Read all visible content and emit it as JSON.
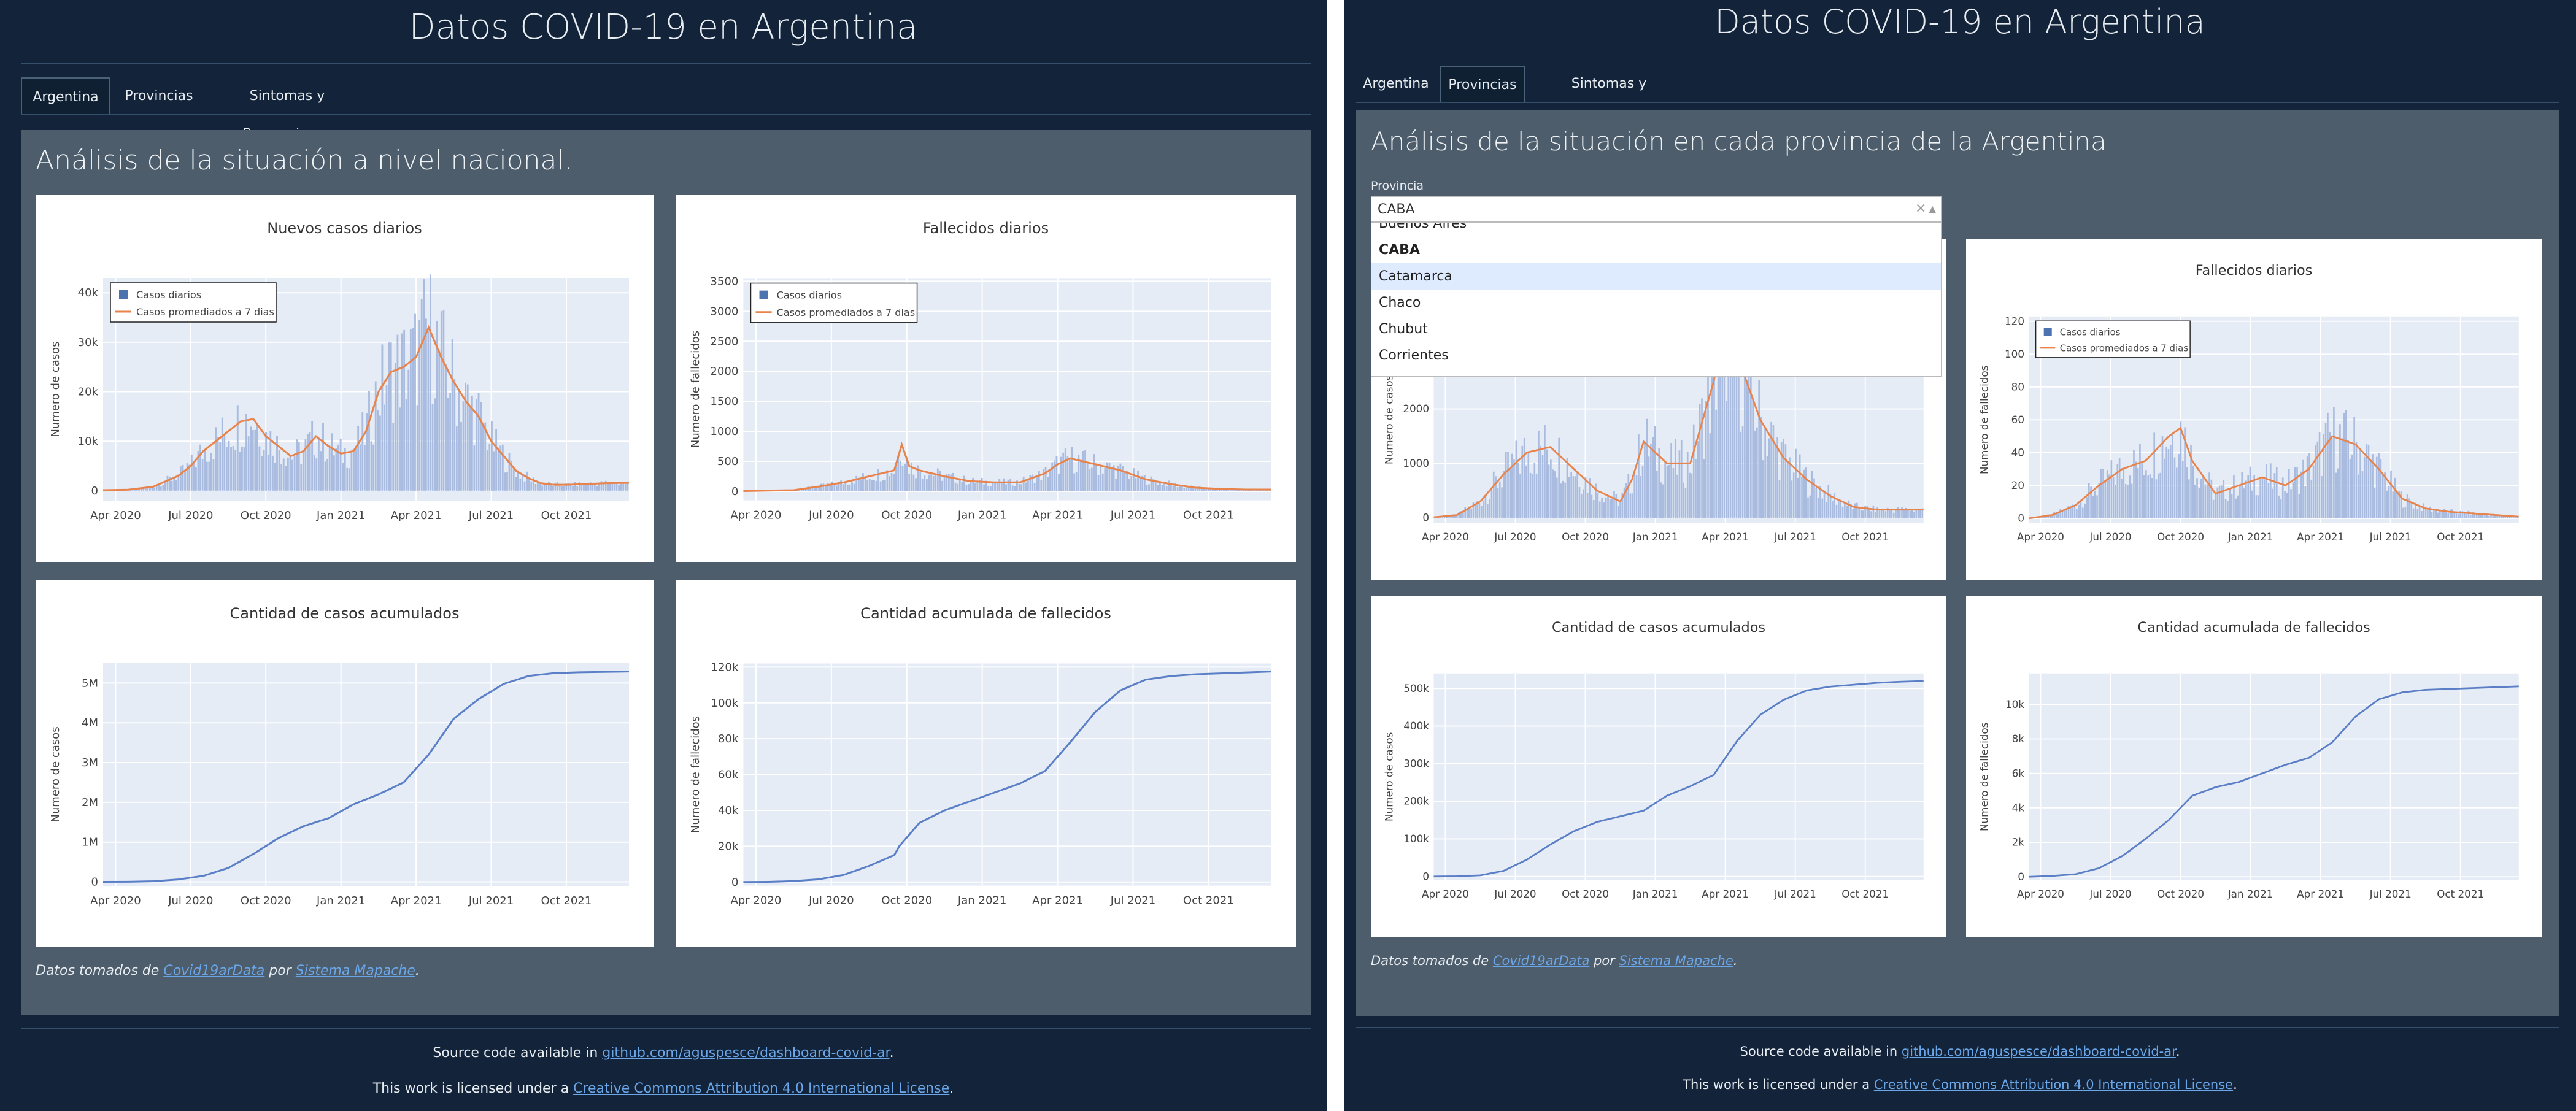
{
  "app": {
    "title": "Datos COVID-19 en Argentina"
  },
  "tabs": [
    {
      "label": "Argentina"
    },
    {
      "label": "Provincias"
    },
    {
      "label": "Sintomas y Precauciones"
    }
  ],
  "national": {
    "heading": "Análisis de la situación a nivel nacional."
  },
  "provincial": {
    "heading": "Análisis de la situación en cada provincia de la Argentina",
    "dropdown": {
      "label": "Provincia",
      "value": "CABA",
      "clear_glyph": "×",
      "arrow_glyph": "▲",
      "options": [
        "Buenos Aires",
        "CABA",
        "Catamarca",
        "Chaco",
        "Chubut",
        "Corrientes"
      ],
      "selected": "CABA",
      "highlighted": "Catamarca"
    }
  },
  "caption": {
    "prefix": "Datos tomados de ",
    "source": "Covid19arData",
    "mid": " por ",
    "author": "Sistema Mapache",
    "suffix": "."
  },
  "footer": {
    "line1_prefix": "Source code available in ",
    "line1_link": "github.com/aguspesce/dashboard-covid-ar",
    "line1_suffix": ".",
    "line2_prefix": "This work is licensed under a ",
    "line2_link": "Creative Commons Attribution 4.0 International License",
    "line2_suffix": "."
  },
  "colors": {
    "page_bg": "#12233a",
    "panel_bg": "#4d5d6c",
    "plot_bg": "#e5ecf6",
    "bar": "#a9bce0",
    "bar_legend": "#4c72b0",
    "avg_line": "#e8834b",
    "cum_line": "#5b7fc7",
    "link": "#6ba7e8"
  },
  "chart_data": [
    {
      "id": "ar-daily-cases",
      "type": "bar+line",
      "title": "Nuevos casos diarios",
      "xlabel": "",
      "ylabel": "Numero de casos",
      "x_ticks": [
        "Apr 2020",
        "Jul 2020",
        "Oct 2020",
        "Jan 2021",
        "Apr 2021",
        "Jul 2021",
        "Oct 2021"
      ],
      "y_ticks": [
        "0",
        "10k",
        "20k",
        "30k",
        "40k"
      ],
      "y_tick_values": [
        0,
        10000,
        20000,
        30000,
        40000
      ],
      "ylim": [
        -2000,
        43000
      ],
      "xlim": [
        0,
        21
      ],
      "legend": {
        "position": "top-left",
        "entries": [
          "Casos diarios",
          "Casos promediados a 7 dias"
        ]
      },
      "series": [
        {
          "name": "Casos promediados a 7 dias",
          "x": [
            0,
            1,
            2,
            3,
            3.5,
            4,
            4.5,
            5,
            5.5,
            6,
            6.5,
            7,
            7.5,
            8,
            8.5,
            9,
            9.5,
            10,
            10.5,
            11,
            11.5,
            12,
            12.5,
            13,
            13.5,
            14,
            14.5,
            15,
            15.5,
            16,
            16.5,
            17,
            17.5,
            18,
            18.5,
            19,
            19.5,
            20,
            21
          ],
          "y": [
            100,
            200,
            800,
            3000,
            5000,
            8000,
            10000,
            12000,
            14000,
            14500,
            11000,
            9000,
            7000,
            8000,
            11000,
            9000,
            7500,
            8000,
            12000,
            20000,
            24000,
            25000,
            27000,
            33000,
            27000,
            22000,
            18000,
            15000,
            10000,
            7000,
            4000,
            2500,
            1500,
            1200,
            1200,
            1300,
            1400,
            1500,
            1600
          ]
        }
      ]
    },
    {
      "id": "ar-daily-deaths",
      "type": "bar+line",
      "title": "Fallecidos diarios",
      "xlabel": "",
      "ylabel": "Numero de fallecidos",
      "x_ticks": [
        "Apr 2020",
        "Jul 2020",
        "Oct 2020",
        "Jan 2021",
        "Apr 2021",
        "Jul 2021",
        "Oct 2021"
      ],
      "y_ticks": [
        "0",
        "500",
        "1000",
        "1500",
        "2000",
        "2500",
        "3000",
        "3500"
      ],
      "y_tick_values": [
        0,
        500,
        1000,
        1500,
        2000,
        2500,
        3000,
        3500
      ],
      "ylim": [
        -150,
        3550
      ],
      "xlim": [
        0,
        21
      ],
      "legend": {
        "position": "top-left",
        "entries": [
          "Casos diarios",
          "Casos promediados a 7 dias"
        ]
      },
      "series": [
        {
          "name": "Casos promediados a 7 dias",
          "x": [
            0,
            2,
            3,
            4,
            5,
            6,
            6.3,
            6.6,
            7,
            8,
            9,
            10,
            11,
            12,
            12.5,
            13,
            13.5,
            14,
            15,
            16,
            17,
            18,
            19,
            20,
            21
          ],
          "y": [
            5,
            20,
            80,
            150,
            250,
            350,
            780,
            420,
            350,
            250,
            170,
            150,
            150,
            300,
            450,
            550,
            500,
            450,
            350,
            200,
            120,
            60,
            40,
            30,
            30
          ]
        }
      ]
    },
    {
      "id": "ar-cum-cases",
      "type": "line",
      "title": "Cantidad de casos acumulados",
      "xlabel": "",
      "ylabel": "Numero de casos",
      "x_ticks": [
        "Apr 2020",
        "Jul 2020",
        "Oct 2020",
        "Jan 2021",
        "Apr 2021",
        "Jul 2021",
        "Oct 2021"
      ],
      "y_ticks": [
        "0",
        "1M",
        "2M",
        "3M",
        "4M",
        "5M"
      ],
      "y_tick_values": [
        0,
        1000000,
        2000000,
        3000000,
        4000000,
        5000000
      ],
      "ylim": [
        -100000,
        5500000
      ],
      "xlim": [
        0,
        21
      ],
      "series": [
        {
          "name": "",
          "x": [
            0,
            1,
            2,
            3,
            4,
            5,
            6,
            7,
            8,
            9,
            10,
            11,
            12,
            13,
            14,
            15,
            16,
            17,
            18,
            19,
            20,
            21
          ],
          "y": [
            0,
            2000,
            15000,
            60000,
            150000,
            350000,
            700000,
            1100000,
            1400000,
            1600000,
            1950000,
            2200000,
            2500000,
            3200000,
            4100000,
            4600000,
            4980000,
            5180000,
            5250000,
            5270000,
            5280000,
            5290000
          ]
        }
      ]
    },
    {
      "id": "ar-cum-deaths",
      "type": "line",
      "title": "Cantidad acumulada de fallecidos",
      "xlabel": "",
      "ylabel": "Numero de fallecidos",
      "x_ticks": [
        "Apr 2020",
        "Jul 2020",
        "Oct 2020",
        "Jan 2021",
        "Apr 2021",
        "Jul 2021",
        "Oct 2021"
      ],
      "y_ticks": [
        "0",
        "20k",
        "40k",
        "60k",
        "80k",
        "100k",
        "120k"
      ],
      "y_tick_values": [
        0,
        20000,
        40000,
        60000,
        80000,
        100000,
        120000
      ],
      "ylim": [
        -2000,
        122000
      ],
      "xlim": [
        0,
        21
      ],
      "series": [
        {
          "name": "",
          "x": [
            0,
            1,
            2,
            3,
            4,
            5,
            6,
            6.2,
            7,
            8,
            9,
            10,
            11,
            12,
            13,
            14,
            15,
            16,
            17,
            18,
            19,
            20,
            21
          ],
          "y": [
            0,
            100,
            500,
            1500,
            4000,
            9000,
            15000,
            20000,
            33000,
            40000,
            45000,
            50000,
            55000,
            62000,
            78000,
            95000,
            107000,
            113000,
            115000,
            116000,
            116500,
            117000,
            117500
          ]
        }
      ]
    },
    {
      "id": "prov-daily-cases",
      "type": "bar+line",
      "title": "",
      "xlabel": "",
      "ylabel": "Numero de casos",
      "x_ticks": [
        "Apr 2020",
        "Jul 2020",
        "Oct 2020",
        "Jan 2021",
        "Apr 2021",
        "Jul 2021",
        "Oct 2021"
      ],
      "y_ticks": [
        "0",
        "1000",
        "2000"
      ],
      "y_tick_values": [
        0,
        1000,
        2000
      ],
      "ylim": [
        -100,
        3700
      ],
      "xlim": [
        0,
        21
      ],
      "series": [
        {
          "name": "",
          "x": [
            0,
            1,
            2,
            3,
            4,
            5,
            6,
            7,
            8,
            8.5,
            9,
            10,
            11,
            12,
            12.5,
            13,
            14,
            15,
            16,
            17,
            18,
            19,
            20,
            21
          ],
          "y": [
            10,
            50,
            300,
            800,
            1200,
            1300,
            900,
            500,
            300,
            700,
            1400,
            1000,
            1000,
            2500,
            3500,
            3000,
            1800,
            1100,
            700,
            400,
            200,
            150,
            150,
            150
          ]
        }
      ]
    },
    {
      "id": "prov-daily-deaths",
      "type": "bar+line",
      "title": "Fallecidos diarios",
      "xlabel": "",
      "ylabel": "Numero de fallecidos",
      "x_ticks": [
        "Apr 2020",
        "Jul 2020",
        "Oct 2020",
        "Jan 2021",
        "Apr 2021",
        "Jul 2021",
        "Oct 2021"
      ],
      "y_ticks": [
        "0",
        "20",
        "40",
        "60",
        "80",
        "100",
        "120"
      ],
      "y_tick_values": [
        0,
        20,
        40,
        60,
        80,
        100,
        120
      ],
      "ylim": [
        -3,
        123
      ],
      "xlim": [
        0,
        21
      ],
      "legend": {
        "position": "top-left",
        "entries": [
          "Casos diarios",
          "Casos promediados a 7 dias"
        ]
      },
      "series": [
        {
          "name": "Casos promediados a 7 dias",
          "x": [
            0,
            1,
            2,
            3,
            4,
            5,
            6,
            6.5,
            7,
            8,
            9,
            10,
            11,
            12,
            13,
            14,
            15,
            16,
            17,
            18,
            19,
            20,
            21
          ],
          "y": [
            0,
            2,
            8,
            20,
            30,
            35,
            50,
            55,
            35,
            15,
            20,
            25,
            20,
            30,
            50,
            45,
            30,
            12,
            6,
            4,
            3,
            2,
            1
          ]
        }
      ]
    },
    {
      "id": "prov-cum-cases",
      "type": "line",
      "title": "Cantidad de casos acumulados",
      "xlabel": "",
      "ylabel": "Numero de casos",
      "x_ticks": [
        "Apr 2020",
        "Jul 2020",
        "Oct 2020",
        "Jan 2021",
        "Apr 2021",
        "Jul 2021",
        "Oct 2021"
      ],
      "y_ticks": [
        "0",
        "100k",
        "200k",
        "300k",
        "400k",
        "500k"
      ],
      "y_tick_values": [
        0,
        100000,
        200000,
        300000,
        400000,
        500000
      ],
      "ylim": [
        -10000,
        540000
      ],
      "xlim": [
        0,
        21
      ],
      "series": [
        {
          "name": "",
          "x": [
            0,
            1,
            2,
            3,
            4,
            5,
            6,
            7,
            8,
            9,
            10,
            11,
            12,
            13,
            14,
            15,
            16,
            17,
            18,
            19,
            20,
            21
          ],
          "y": [
            0,
            500,
            3000,
            15000,
            45000,
            85000,
            120000,
            145000,
            160000,
            175000,
            215000,
            240000,
            270000,
            360000,
            430000,
            470000,
            495000,
            505000,
            510000,
            515000,
            518000,
            520000
          ]
        }
      ]
    },
    {
      "id": "prov-cum-deaths",
      "type": "line",
      "title": "Cantidad acumulada de fallecidos",
      "xlabel": "",
      "ylabel": "Numero de fallecidos",
      "x_ticks": [
        "Apr 2020",
        "Jul 2020",
        "Oct 2020",
        "Jan 2021",
        "Apr 2021",
        "Jul 2021",
        "Oct 2021"
      ],
      "y_ticks": [
        "0",
        "2k",
        "4k",
        "6k",
        "8k",
        "10k"
      ],
      "y_tick_values": [
        0,
        2000,
        4000,
        6000,
        8000,
        10000
      ],
      "ylim": [
        -200,
        11800
      ],
      "xlim": [
        0,
        21
      ],
      "series": [
        {
          "name": "",
          "x": [
            0,
            1,
            2,
            3,
            4,
            5,
            6,
            7,
            8,
            9,
            10,
            11,
            12,
            13,
            14,
            15,
            16,
            17,
            18,
            19,
            20,
            21
          ],
          "y": [
            0,
            50,
            150,
            500,
            1200,
            2200,
            3300,
            4700,
            5200,
            5500,
            6000,
            6500,
            6900,
            7800,
            9300,
            10300,
            10700,
            10850,
            10900,
            10950,
            11000,
            11050
          ]
        }
      ]
    }
  ]
}
